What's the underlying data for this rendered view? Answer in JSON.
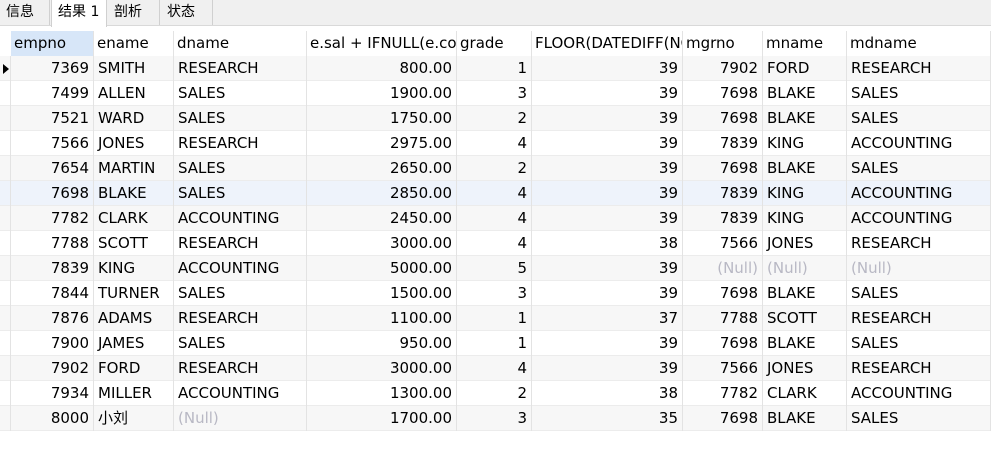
{
  "tabs": [
    {
      "label": "信息",
      "active": false
    },
    {
      "label": "结果 1",
      "active": true
    },
    {
      "label": "剖析",
      "active": false
    },
    {
      "label": "状态",
      "active": false
    }
  ],
  "columns": [
    "empno",
    "ename",
    "dname",
    "e.sal + IFNULL(e.com",
    "grade",
    "FLOOR(DATEDIFF(NO",
    "mgrno",
    "mname",
    "mdname"
  ],
  "rows": [
    [
      "7369",
      "SMITH",
      "RESEARCH",
      "800.00",
      "1",
      "39",
      "7902",
      "FORD",
      "RESEARCH"
    ],
    [
      "7499",
      "ALLEN",
      "SALES",
      "1900.00",
      "3",
      "39",
      "7698",
      "BLAKE",
      "SALES"
    ],
    [
      "7521",
      "WARD",
      "SALES",
      "1750.00",
      "2",
      "39",
      "7698",
      "BLAKE",
      "SALES"
    ],
    [
      "7566",
      "JONES",
      "RESEARCH",
      "2975.00",
      "4",
      "39",
      "7839",
      "KING",
      "ACCOUNTING"
    ],
    [
      "7654",
      "MARTIN",
      "SALES",
      "2650.00",
      "2",
      "39",
      "7698",
      "BLAKE",
      "SALES"
    ],
    [
      "7698",
      "BLAKE",
      "SALES",
      "2850.00",
      "4",
      "39",
      "7839",
      "KING",
      "ACCOUNTING"
    ],
    [
      "7782",
      "CLARK",
      "ACCOUNTING",
      "2450.00",
      "4",
      "39",
      "7839",
      "KING",
      "ACCOUNTING"
    ],
    [
      "7788",
      "SCOTT",
      "RESEARCH",
      "3000.00",
      "4",
      "38",
      "7566",
      "JONES",
      "RESEARCH"
    ],
    [
      "7839",
      "KING",
      "ACCOUNTING",
      "5000.00",
      "5",
      "39",
      "(Null)",
      "(Null)",
      "(Null)"
    ],
    [
      "7844",
      "TURNER",
      "SALES",
      "1500.00",
      "3",
      "39",
      "7698",
      "BLAKE",
      "SALES"
    ],
    [
      "7876",
      "ADAMS",
      "RESEARCH",
      "1100.00",
      "1",
      "37",
      "7788",
      "SCOTT",
      "RESEARCH"
    ],
    [
      "7900",
      "JAMES",
      "SALES",
      "950.00",
      "1",
      "39",
      "7698",
      "BLAKE",
      "SALES"
    ],
    [
      "7902",
      "FORD",
      "RESEARCH",
      "3000.00",
      "4",
      "39",
      "7566",
      "JONES",
      "RESEARCH"
    ],
    [
      "7934",
      "MILLER",
      "ACCOUNTING",
      "1300.00",
      "2",
      "38",
      "7782",
      "CLARK",
      "ACCOUNTING"
    ],
    [
      "8000",
      "小刘",
      "(Null)",
      "1700.00",
      "3",
      "35",
      "7698",
      "BLAKE",
      "SALES"
    ]
  ],
  "null_text": "(Null)",
  "selected_row": 0,
  "colors": {
    "header_first_bg": "#d7e6f8",
    "null_text": "#b8b8c4",
    "alt_row": "#f7f7f7",
    "highlight_row": "#eef3fb"
  }
}
